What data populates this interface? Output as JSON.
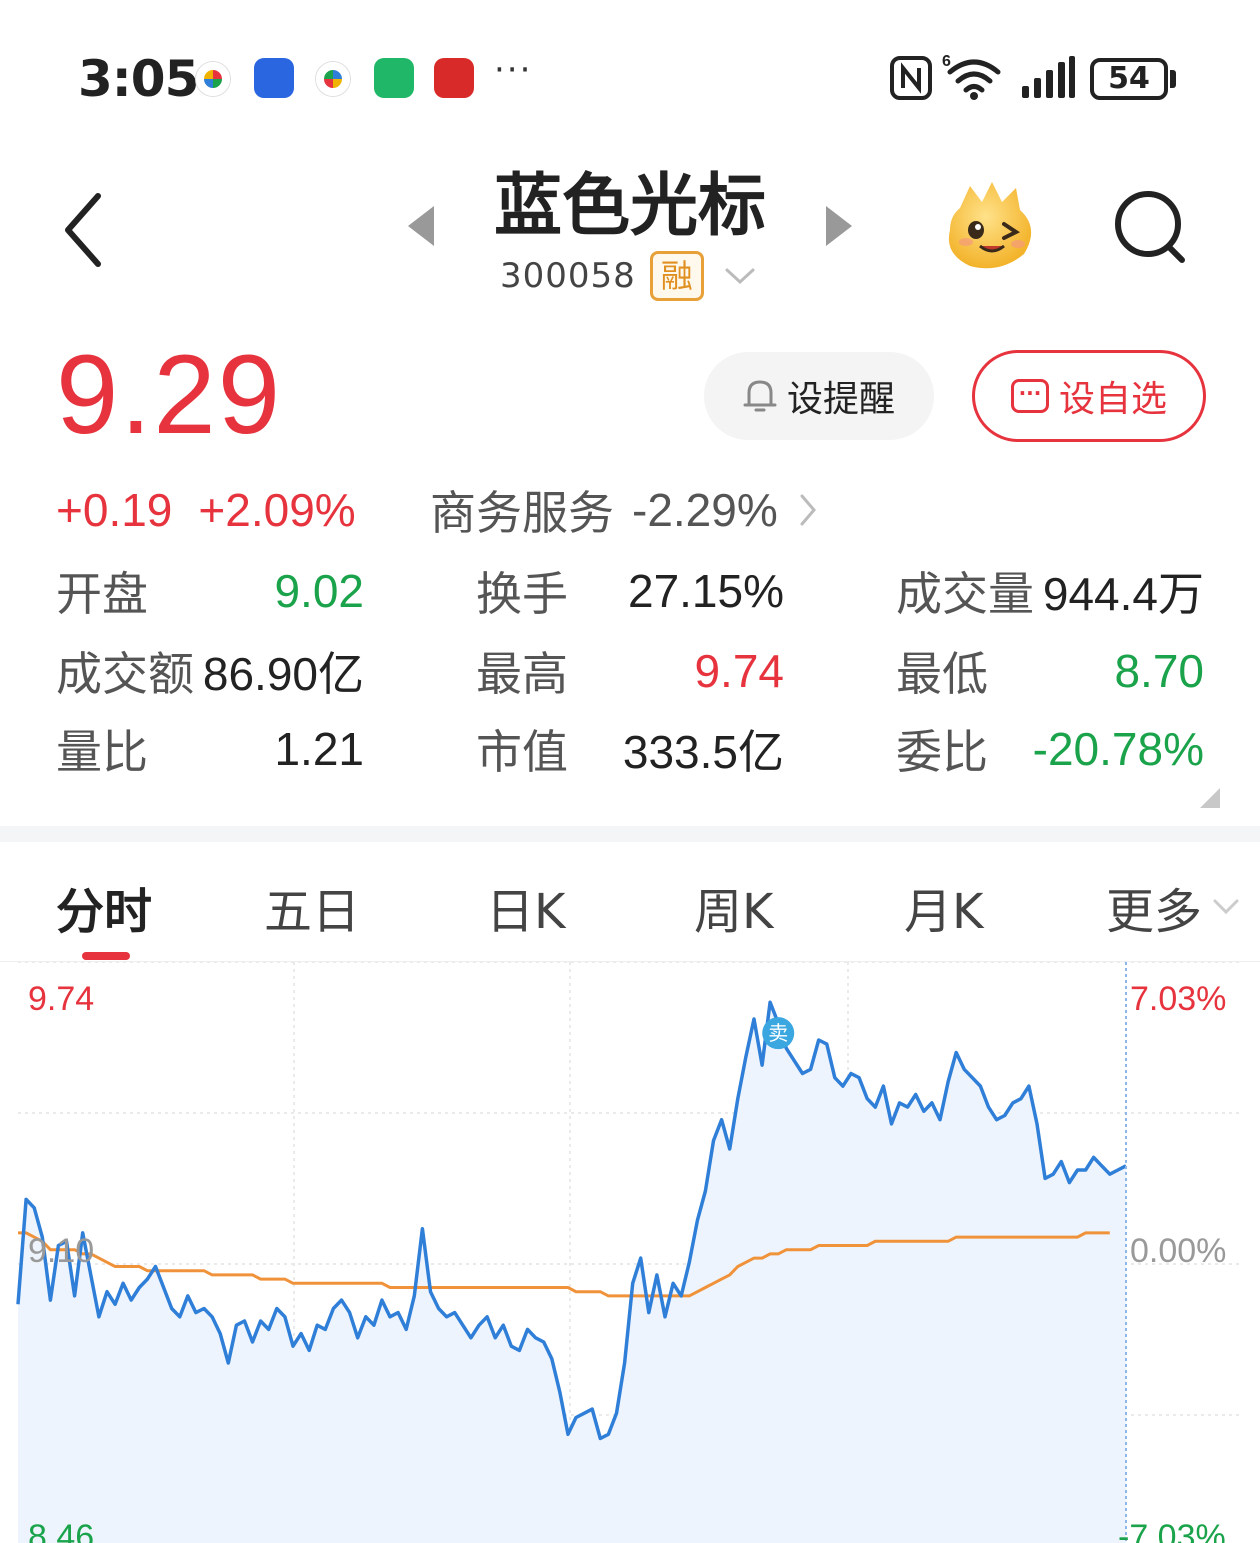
{
  "status_bar": {
    "time": "3:05",
    "notification_icons": [
      "app-icon",
      "hand-shield-icon",
      "app-icon",
      "mi-icon",
      "broker-app-icon"
    ],
    "more": "···",
    "battery": "54",
    "icons": [
      "nfc-icon",
      "wifi-6-icon",
      "signal-icon",
      "battery-icon"
    ]
  },
  "header": {
    "stock_name": "蓝色光标",
    "stock_code": "300058",
    "margin_badge": "融"
  },
  "quote": {
    "last_price": "9.29",
    "change_abs": "+0.19",
    "change_pct": "+2.09%",
    "sector_name": "商务服务",
    "sector_change": "-2.29%",
    "alert_label": "设提醒",
    "watchlist_label": "设自选"
  },
  "stats": {
    "open_label": "开盘",
    "open_value": "9.02",
    "turnover_label": "换手",
    "turnover_value": "27.15%",
    "volume_label": "成交量",
    "volume_value": "944.4万",
    "amount_label": "成交额",
    "amount_value": "86.90亿",
    "high_label": "最高",
    "high_value": "9.74",
    "low_label": "最低",
    "low_value": "8.70",
    "vol_ratio_label": "量比",
    "vol_ratio_value": "1.21",
    "mkt_cap_label": "市值",
    "mkt_cap_value": "333.5亿",
    "commission_ratio_label": "委比",
    "commission_ratio_value": "-20.78%"
  },
  "tabs": [
    {
      "label": "分时",
      "active": true
    },
    {
      "label": "五日"
    },
    {
      "label": "日K"
    },
    {
      "label": "周K"
    },
    {
      "label": "月K"
    },
    {
      "label": "更多"
    }
  ],
  "chart_data": {
    "type": "line",
    "y_left_labels": [
      "9.74",
      "9.10",
      "8.46"
    ],
    "y_right_labels": [
      "7.03%",
      "0.00%",
      "-7.03%"
    ],
    "ylim": [
      8.46,
      9.74
    ],
    "reference_price": 9.1,
    "marker_label": "卖",
    "colors": {
      "price": "#2f7fd8",
      "average": "#f0923a",
      "up": "#e6333d",
      "down": "#1aa34a"
    },
    "series": [
      {
        "values": [
          9.01,
          9.26,
          9.24,
          9.17,
          9.02,
          9.15,
          9.16,
          9.03,
          9.18,
          9.08,
          8.98,
          9.04,
          9.01,
          9.06,
          9.02,
          9.05,
          9.07,
          9.1,
          9.05,
          9.0,
          8.98,
          9.03,
          8.99,
          9.0,
          8.98,
          8.94,
          8.87,
          8.96,
          8.97,
          8.92,
          8.97,
          8.95,
          9.0,
          8.98,
          8.91,
          8.94,
          8.9,
          8.96,
          8.95,
          9.0,
          9.02,
          8.99,
          8.93,
          8.98,
          8.96,
          9.02,
          8.98,
          8.99,
          8.95,
          9.03,
          9.19,
          9.04,
          9.0,
          8.98,
          8.99,
          8.96,
          8.93,
          8.96,
          8.98,
          8.93,
          8.96,
          8.91,
          8.9,
          8.95,
          8.93,
          8.92,
          8.88,
          8.8,
          8.7,
          8.74,
          8.75,
          8.76,
          8.69,
          8.7,
          8.75,
          8.87,
          9.06,
          9.12,
          8.99,
          9.08,
          8.98,
          9.06,
          9.03,
          9.11,
          9.21,
          9.28,
          9.4,
          9.45,
          9.38,
          9.5,
          9.6,
          9.69,
          9.58,
          9.73,
          9.68,
          9.62,
          9.59,
          9.56,
          9.57,
          9.64,
          9.63,
          9.55,
          9.53,
          9.56,
          9.55,
          9.5,
          9.48,
          9.53,
          9.44,
          9.49,
          9.48,
          9.51,
          9.47,
          9.49,
          9.45,
          9.54,
          9.61,
          9.57,
          9.55,
          9.53,
          9.48,
          9.45,
          9.46,
          9.49,
          9.5,
          9.53,
          9.44,
          9.31,
          9.32,
          9.35,
          9.3,
          9.33,
          9.33,
          9.36,
          9.34,
          9.32,
          9.33,
          9.34
        ]
      },
      {
        "values": [
          9.18,
          9.18,
          9.17,
          9.16,
          9.14,
          9.14,
          9.14,
          9.14,
          9.13,
          9.13,
          9.12,
          9.11,
          9.1,
          9.1,
          9.1,
          9.1,
          9.09,
          9.09,
          9.09,
          9.09,
          9.09,
          9.09,
          9.09,
          9.09,
          9.08,
          9.08,
          9.08,
          9.08,
          9.08,
          9.08,
          9.07,
          9.07,
          9.07,
          9.07,
          9.06,
          9.06,
          9.06,
          9.06,
          9.06,
          9.06,
          9.06,
          9.06,
          9.06,
          9.06,
          9.06,
          9.06,
          9.05,
          9.05,
          9.05,
          9.05,
          9.05,
          9.05,
          9.05,
          9.05,
          9.05,
          9.05,
          9.05,
          9.05,
          9.05,
          9.05,
          9.05,
          9.05,
          9.05,
          9.05,
          9.05,
          9.05,
          9.05,
          9.05,
          9.05,
          9.04,
          9.04,
          9.04,
          9.04,
          9.03,
          9.03,
          9.03,
          9.03,
          9.03,
          9.03,
          9.03,
          9.03,
          9.03,
          9.03,
          9.03,
          9.04,
          9.05,
          9.06,
          9.07,
          9.08,
          9.1,
          9.11,
          9.12,
          9.12,
          9.13,
          9.13,
          9.14,
          9.14,
          9.14,
          9.14,
          9.15,
          9.15,
          9.15,
          9.15,
          9.15,
          9.15,
          9.15,
          9.16,
          9.16,
          9.16,
          9.16,
          9.16,
          9.16,
          9.16,
          9.16,
          9.16,
          9.16,
          9.17,
          9.17,
          9.17,
          9.17,
          9.17,
          9.17,
          9.17,
          9.17,
          9.17,
          9.17,
          9.17,
          9.17,
          9.17,
          9.17,
          9.17,
          9.17,
          9.18,
          9.18,
          9.18,
          9.18
        ]
      }
    ]
  }
}
